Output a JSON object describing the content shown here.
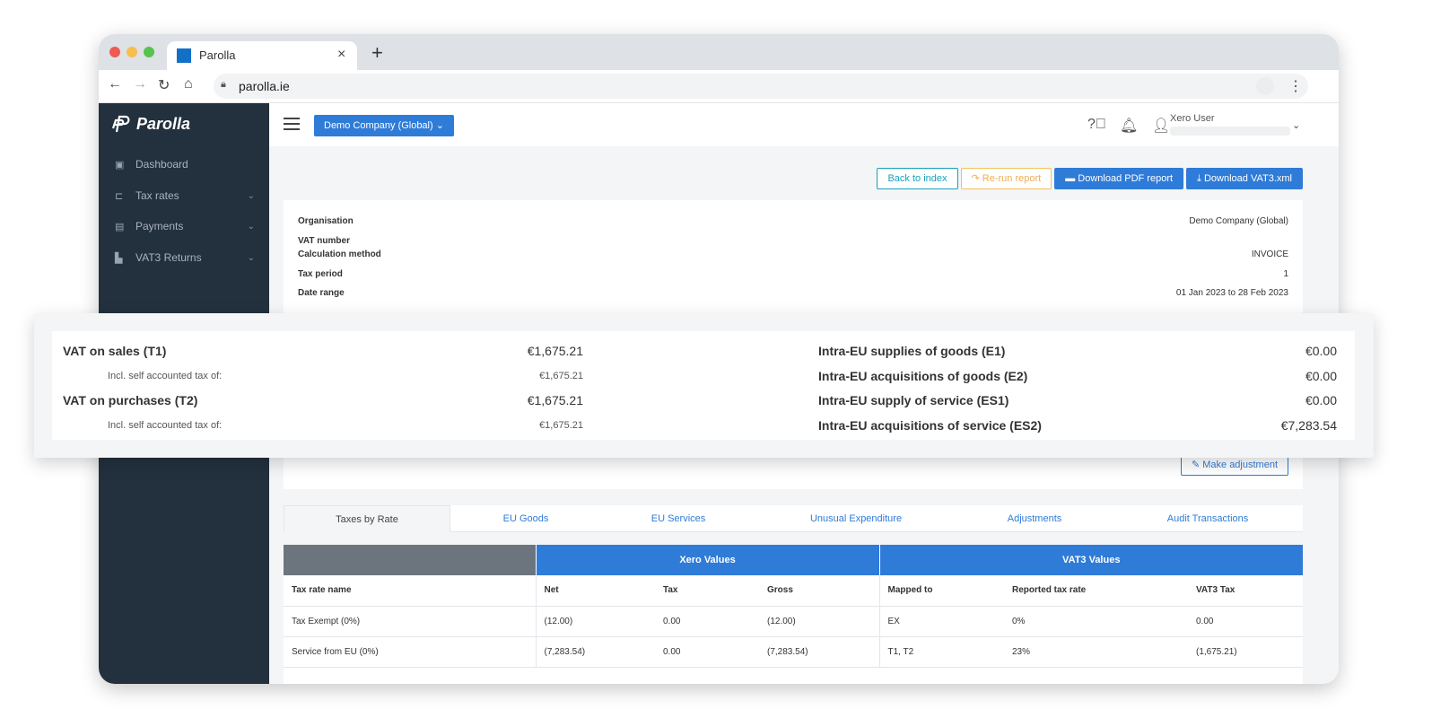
{
  "browser": {
    "tab_title": "Parolla",
    "url": "parolla.ie"
  },
  "app": {
    "logo_text": "Parolla",
    "company_selector": "Demo Company (Global)",
    "user_name": "Xero User"
  },
  "sidebar": {
    "items": [
      {
        "label": "Dashboard",
        "icon": "monitor-icon",
        "has_chevron": false
      },
      {
        "label": "Tax rates",
        "icon": "tax-rates-icon",
        "has_chevron": true
      },
      {
        "label": "Payments",
        "icon": "payments-icon",
        "has_chevron": true
      },
      {
        "label": "VAT3 Returns",
        "icon": "document-icon",
        "has_chevron": true
      }
    ]
  },
  "actions": {
    "back": "Back to index",
    "rerun": "Re-run report",
    "download_pdf": "Download PDF report",
    "download_xml": "Download VAT3.xml"
  },
  "info": [
    {
      "label": "Organisation",
      "value": "Demo Company (Global)"
    },
    {
      "label": "VAT number",
      "value": ""
    },
    {
      "label": "Calculation method",
      "value": "INVOICE"
    },
    {
      "label": "Tax period",
      "value": "1"
    },
    {
      "label": "Date range",
      "value": "01 Jan 2023 to 28 Feb 2023"
    }
  ],
  "make_adjustment": "Make adjustment",
  "summary": {
    "left": [
      {
        "label": "VAT on sales (T1)",
        "value": "€1,675.21",
        "sub_label": "Incl. self accounted tax of:",
        "sub_value": "€1,675.21"
      },
      {
        "label": "VAT on purchases (T2)",
        "value": "€1,675.21",
        "sub_label": "Incl. self accounted tax of:",
        "sub_value": "€1,675.21"
      }
    ],
    "right": [
      {
        "label": "Intra-EU supplies of goods (E1)",
        "value": "€0.00"
      },
      {
        "label": "Intra-EU acquisitions of goods (E2)",
        "value": "€0.00"
      },
      {
        "label": "Intra-EU supply of service (ES1)",
        "value": "€0.00"
      },
      {
        "label": "Intra-EU acquisitions of service (ES2)",
        "value": "€7,283.54"
      }
    ]
  },
  "tabs": [
    "Taxes by Rate",
    "EU Goods",
    "EU Services",
    "Unusual Expenditure",
    "Adjustments",
    "Audit Transactions"
  ],
  "active_tab": "Taxes by Rate",
  "table": {
    "group_headers": [
      "",
      "Xero Values",
      "VAT3 Values"
    ],
    "columns": [
      "Tax rate name",
      "Net",
      "Tax",
      "Gross",
      "Mapped to",
      "Reported tax rate",
      "VAT3 Tax"
    ],
    "rows": [
      [
        "Tax Exempt (0%)",
        "(12.00)",
        "0.00",
        "(12.00)",
        "EX",
        "0%",
        "0.00"
      ],
      [
        "Service from EU (0%)",
        "(7,283.54)",
        "0.00",
        "(7,283.54)",
        "T1, T2",
        "23%",
        "(1,675.21)"
      ]
    ]
  },
  "colors": {
    "primary": "#2f7bd8",
    "sidebar": "#23303d",
    "teal": "#17a2b8",
    "warning": "#f0ad4e"
  }
}
